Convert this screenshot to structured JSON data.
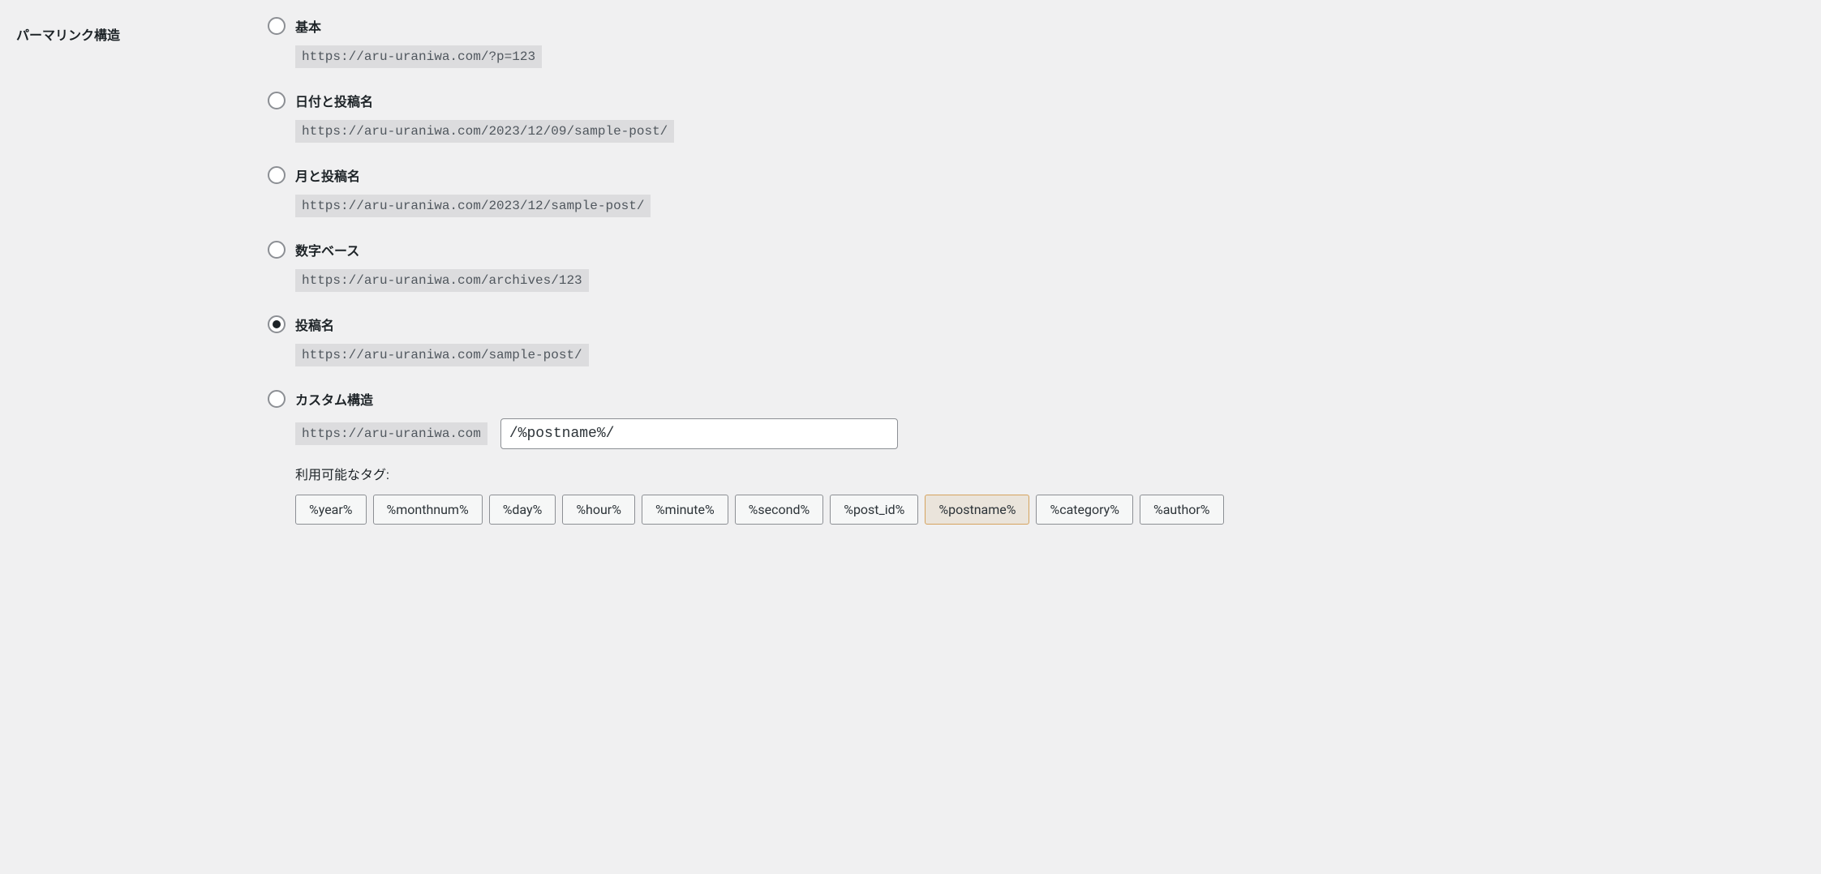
{
  "section_label": "パーマリンク構造",
  "options": [
    {
      "label": "基本",
      "example": "https://aru-uraniwa.com/?p=123",
      "checked": false
    },
    {
      "label": "日付と投稿名",
      "example": "https://aru-uraniwa.com/2023/12/09/sample-post/",
      "checked": false
    },
    {
      "label": "月と投稿名",
      "example": "https://aru-uraniwa.com/2023/12/sample-post/",
      "checked": false
    },
    {
      "label": "数字ベース",
      "example": "https://aru-uraniwa.com/archives/123",
      "checked": false
    },
    {
      "label": "投稿名",
      "example": "https://aru-uraniwa.com/sample-post/",
      "checked": true
    }
  ],
  "custom": {
    "label": "カスタム構造",
    "prefix": "https://aru-uraniwa.com",
    "value": "/%postname%/",
    "checked": false
  },
  "tags_label": "利用可能なタグ:",
  "tags": [
    {
      "label": "%year%",
      "active": false
    },
    {
      "label": "%monthnum%",
      "active": false
    },
    {
      "label": "%day%",
      "active": false
    },
    {
      "label": "%hour%",
      "active": false
    },
    {
      "label": "%minute%",
      "active": false
    },
    {
      "label": "%second%",
      "active": false
    },
    {
      "label": "%post_id%",
      "active": false
    },
    {
      "label": "%postname%",
      "active": true
    },
    {
      "label": "%category%",
      "active": false
    },
    {
      "label": "%author%",
      "active": false
    }
  ]
}
